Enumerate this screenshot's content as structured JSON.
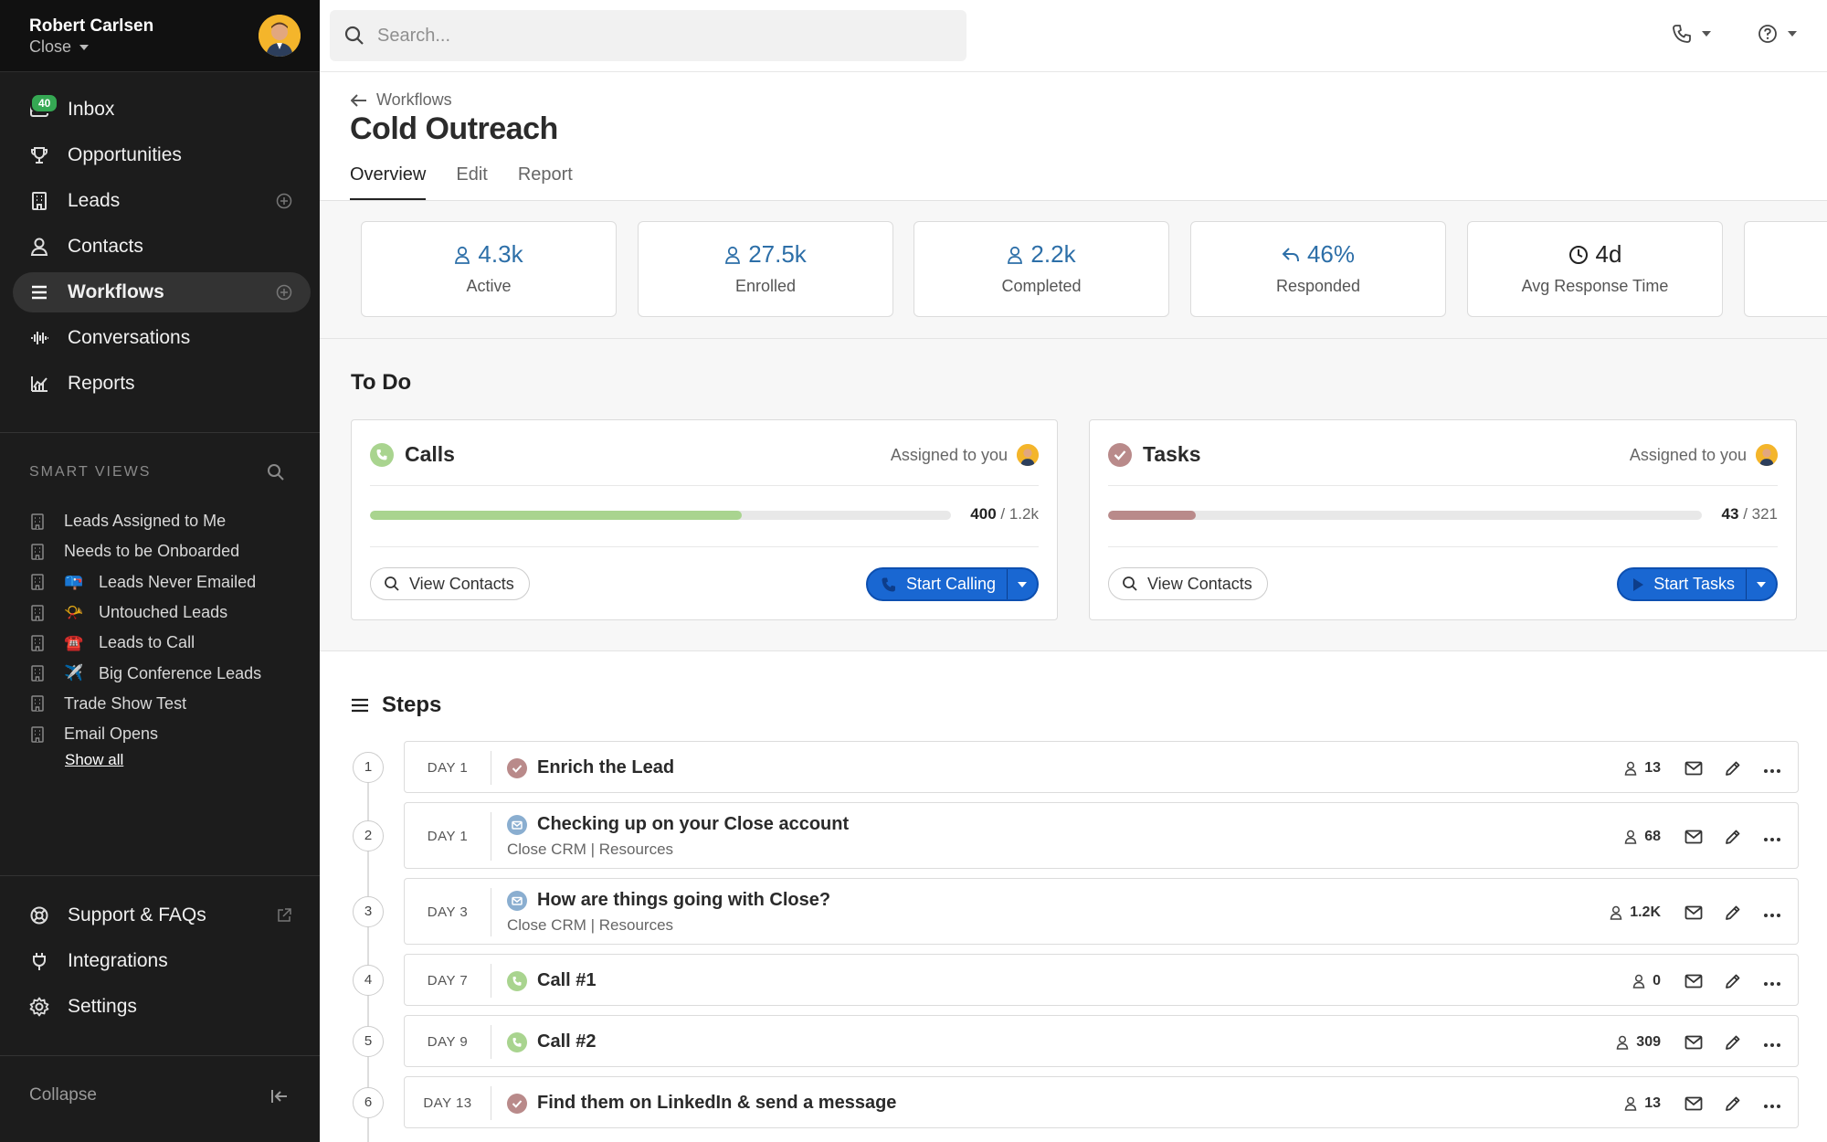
{
  "user": {
    "name": "Robert Carlsen",
    "org": "Close"
  },
  "nav": {
    "items": [
      {
        "label": "Inbox",
        "badge": "40"
      },
      {
        "label": "Opportunities"
      },
      {
        "label": "Leads"
      },
      {
        "label": "Contacts"
      },
      {
        "label": "Workflows"
      },
      {
        "label": "Conversations"
      },
      {
        "label": "Reports"
      }
    ]
  },
  "smart_views": {
    "heading": "SMART VIEWS",
    "items": [
      {
        "label": "Leads Assigned to Me",
        "emoji": ""
      },
      {
        "label": "Needs to be Onboarded",
        "emoji": ""
      },
      {
        "label": "Leads Never Emailed",
        "emoji": "📪"
      },
      {
        "label": "Untouched Leads",
        "emoji": "📯"
      },
      {
        "label": "Leads to Call",
        "emoji": "☎️"
      },
      {
        "label": "Big Conference Leads",
        "emoji": "✈️"
      },
      {
        "label": "Trade Show Test",
        "emoji": ""
      },
      {
        "label": "Email Opens",
        "emoji": ""
      }
    ],
    "show_all": "Show all"
  },
  "bottom_nav": {
    "support": "Support & FAQs",
    "integrations": "Integrations",
    "settings": "Settings",
    "collapse": "Collapse"
  },
  "search": {
    "placeholder": "Search..."
  },
  "header": {
    "back_label": "Workflows",
    "title": "Cold Outreach",
    "tabs": [
      "Overview",
      "Edit",
      "Report"
    ]
  },
  "stats": [
    {
      "value": "4.3k",
      "label": "Active",
      "icon": "person-icon"
    },
    {
      "value": "27.5k",
      "label": "Enrolled",
      "icon": "person-icon"
    },
    {
      "value": "2.2k",
      "label": "Completed",
      "icon": "person-icon"
    },
    {
      "value": "46%",
      "label": "Responded",
      "icon": "reply-icon"
    },
    {
      "value": "4d",
      "label": "Avg Response Time",
      "icon": "clock-icon"
    }
  ],
  "todo": {
    "title": "To Do",
    "calls": {
      "title": "Calls",
      "assigned": "Assigned to you",
      "done": "400",
      "total": "/ 1.2k",
      "progress": 0.64,
      "view_label": "View Contacts",
      "start_label": "Start Calling"
    },
    "tasks": {
      "title": "Tasks",
      "assigned": "Assigned to you",
      "done": "43",
      "total": "/ 321",
      "progress": 0.148,
      "view_label": "View Contacts",
      "start_label": "Start Tasks"
    }
  },
  "steps": {
    "title": "Steps",
    "items": [
      {
        "num": "1",
        "day": "DAY 1",
        "title": "Enrich the Lead",
        "sub": "",
        "type": "task",
        "count": "13"
      },
      {
        "num": "2",
        "day": "DAY 1",
        "title": "Checking up on your Close account",
        "sub": "Close CRM | Resources",
        "type": "email",
        "count": "68"
      },
      {
        "num": "3",
        "day": "DAY 3",
        "title": "How are things going with Close?",
        "sub": "Close CRM | Resources",
        "type": "email",
        "count": "1.2K"
      },
      {
        "num": "4",
        "day": "DAY 7",
        "title": "Call #1",
        "sub": "",
        "type": "call",
        "count": "0"
      },
      {
        "num": "5",
        "day": "DAY 9",
        "title": "Call #2",
        "sub": "",
        "type": "call",
        "count": "309"
      },
      {
        "num": "6",
        "day": "DAY 13",
        "title": "Find them on LinkedIn & send a message",
        "sub": "",
        "type": "task",
        "count": "13"
      }
    ]
  },
  "colors": {
    "sidebar_bg": "#1c1c1c",
    "accent_blue": "#1967d2",
    "stat_blue": "#2d6fa8",
    "call_green": "#a9d48f",
    "task_rose": "#b98a8a",
    "email_blue": "#8aaed0"
  }
}
